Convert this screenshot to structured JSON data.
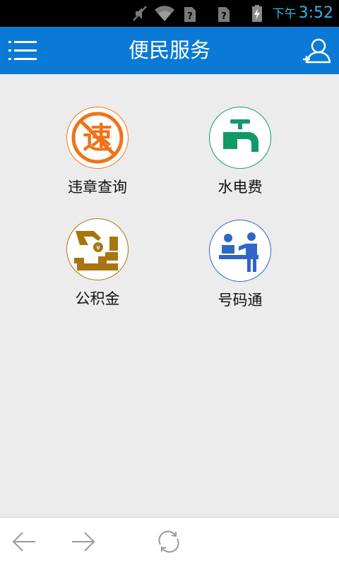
{
  "status_bar": {
    "ampm": "下午",
    "time": "3:52",
    "icons": [
      "mute-icon",
      "wifi-icon",
      "sim-unknown-icon",
      "sim-unknown-icon",
      "battery-charging-icon"
    ]
  },
  "app_bar": {
    "title": "便民服务",
    "left_icon": "menu-list-icon",
    "right_icon": "user-add-icon"
  },
  "services": [
    {
      "label": "违章查询",
      "icon": "traffic-violation-icon",
      "color": "#f07318"
    },
    {
      "label": "水电费",
      "icon": "water-faucet-icon",
      "color": "#129a66"
    },
    {
      "label": "公积金",
      "icon": "housing-fund-icon",
      "color": "#a8750f"
    },
    {
      "label": "号码通",
      "icon": "number-service-icon",
      "color": "#2f66c8"
    }
  ],
  "violation_icon_char": "速",
  "bottom_bar": {
    "icons": [
      "back-arrow-icon",
      "forward-arrow-icon",
      "refresh-icon"
    ]
  }
}
